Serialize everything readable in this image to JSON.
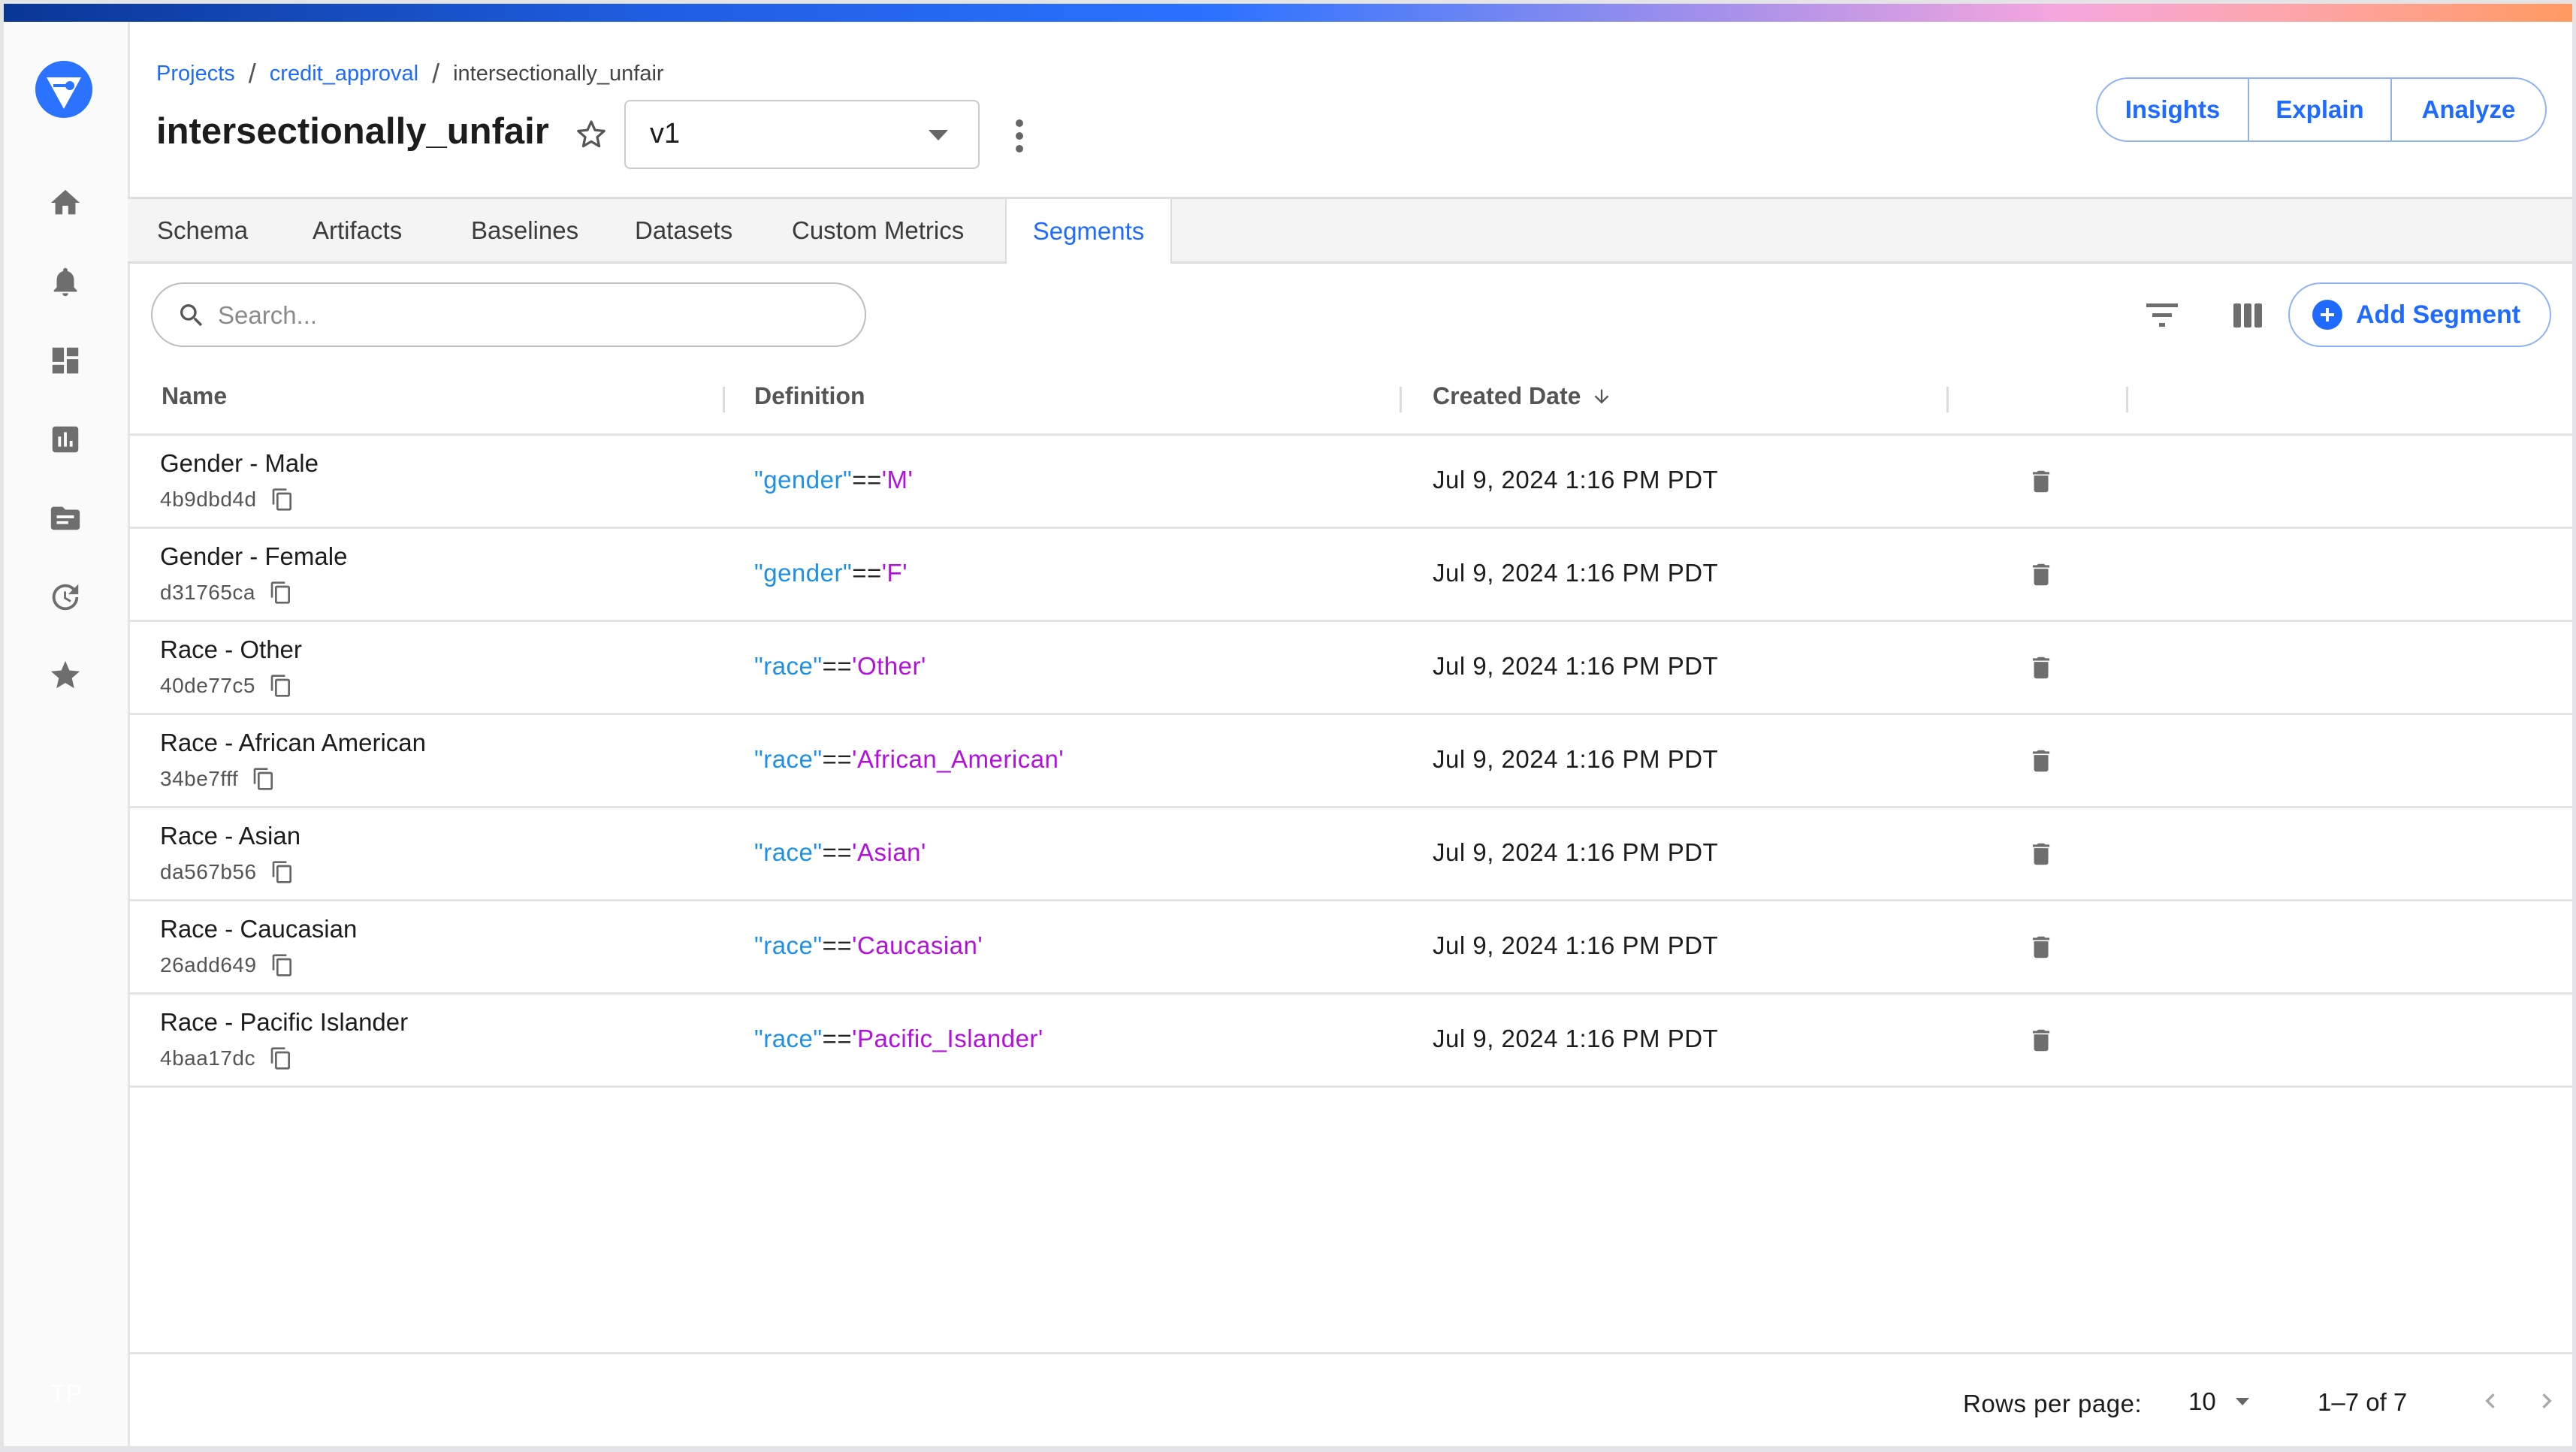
{
  "app": {
    "logo": "fiddler-logo",
    "sidebar": [
      {
        "icon": "home-icon",
        "label": "Home"
      },
      {
        "icon": "bell-icon",
        "label": "Alerts"
      },
      {
        "icon": "dashboard-icon",
        "label": "Dashboards"
      },
      {
        "icon": "chart-icon",
        "label": "Charts"
      },
      {
        "icon": "folder-icon",
        "label": "Projects"
      },
      {
        "icon": "history-icon",
        "label": "History"
      },
      {
        "icon": "star-icon",
        "label": "Bookmarks"
      }
    ],
    "user_initials": "TP"
  },
  "header": {
    "breadcrumb": [
      {
        "label": "Projects",
        "link": true
      },
      {
        "label": "credit_approval",
        "link": true
      },
      {
        "label": "intersectionally_unfair",
        "link": false
      }
    ],
    "title": "intersectionally_unfair",
    "version": "v1",
    "actions": [
      "Insights",
      "Explain",
      "Analyze"
    ]
  },
  "tabs": {
    "items": [
      "Schema",
      "Artifacts",
      "Baselines",
      "Datasets",
      "Custom Metrics",
      "Segments"
    ],
    "active": "Segments"
  },
  "toolbar": {
    "search_placeholder": "Search...",
    "search_value": "",
    "add_label": "Add Segment"
  },
  "table": {
    "columns": {
      "name": "Name",
      "definition": "Definition",
      "created": "Created Date"
    },
    "sort": {
      "column": "Created Date",
      "direction": "desc"
    },
    "rows": [
      {
        "name": "Gender - Male",
        "id": "4b9dbd4d",
        "def_key": "\"gender\"",
        "def_op": "==",
        "def_val": "'M'",
        "created": "Jul 9, 2024 1:16 PM PDT"
      },
      {
        "name": "Gender - Female",
        "id": "d31765ca",
        "def_key": "\"gender\"",
        "def_op": "==",
        "def_val": "'F'",
        "created": "Jul 9, 2024 1:16 PM PDT"
      },
      {
        "name": "Race - Other",
        "id": "40de77c5",
        "def_key": "\"race\"",
        "def_op": "==",
        "def_val": "'Other'",
        "created": "Jul 9, 2024 1:16 PM PDT"
      },
      {
        "name": "Race - African American",
        "id": "34be7fff",
        "def_key": "\"race\"",
        "def_op": "==",
        "def_val": "'African_American'",
        "created": "Jul 9, 2024 1:16 PM PDT"
      },
      {
        "name": "Race - Asian",
        "id": "da567b56",
        "def_key": "\"race\"",
        "def_op": "==",
        "def_val": "'Asian'",
        "created": "Jul 9, 2024 1:16 PM PDT"
      },
      {
        "name": "Race - Caucasian",
        "id": "26add649",
        "def_key": "\"race\"",
        "def_op": "==",
        "def_val": "'Caucasian'",
        "created": "Jul 9, 2024 1:16 PM PDT"
      },
      {
        "name": "Race - Pacific Islander",
        "id": "4baa17dc",
        "def_key": "\"race\"",
        "def_op": "==",
        "def_val": "'Pacific_Islander'",
        "created": "Jul 9, 2024 1:16 PM PDT"
      }
    ]
  },
  "pagination": {
    "rows_per_page_label": "Rows per page:",
    "rows_per_page": "10",
    "range": "1–7 of 7"
  },
  "colors": {
    "accent": "#1f6bff",
    "def_key": "#1e90e6",
    "def_value": "#b310e0",
    "icon_gray": "#6e6e6e"
  }
}
